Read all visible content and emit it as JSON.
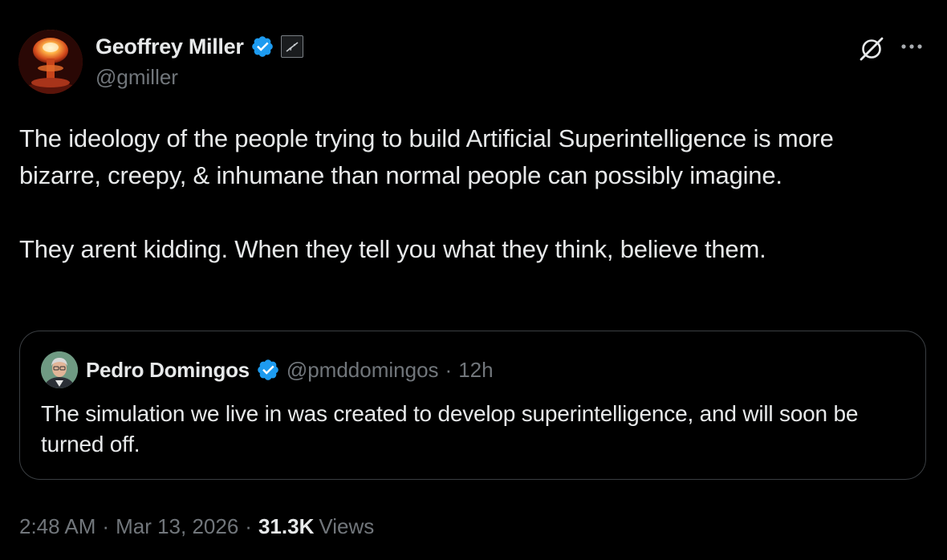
{
  "author": {
    "display_name": "Geoffrey Miller",
    "handle": "@gmiller",
    "verified": true,
    "avatar_icon": "nuclear-explosion-avatar",
    "affiliation_icon": "affiliation-badge-icon"
  },
  "actions": {
    "grok_icon": "grok-icon",
    "more_icon": "more-options-icon"
  },
  "tweet": {
    "paragraphs": [
      "The ideology of the people trying to build Artificial Superintelligence is more bizarre, creepy, & inhumane than normal people can possibly imagine.",
      "They arent kidding. When they tell you what they think, believe them."
    ]
  },
  "quote": {
    "display_name": "Pedro Domingos",
    "handle": "@pmddomingos",
    "separator": "·",
    "time_ago": "12h",
    "verified": true,
    "avatar_icon": "user-photo-avatar",
    "text": "The simulation we live in was created to develop superintelligence, and will soon be turned off."
  },
  "meta": {
    "time": "2:48 AM",
    "separator": "·",
    "date": "Mar 13, 2026",
    "views_count": "31.3K",
    "views_label": "Views"
  },
  "colors": {
    "background": "#000000",
    "primary_text": "#e7e9ea",
    "secondary_text": "#71767b",
    "verified_blue": "#1d9bf0",
    "card_border": "#3a3e42"
  }
}
